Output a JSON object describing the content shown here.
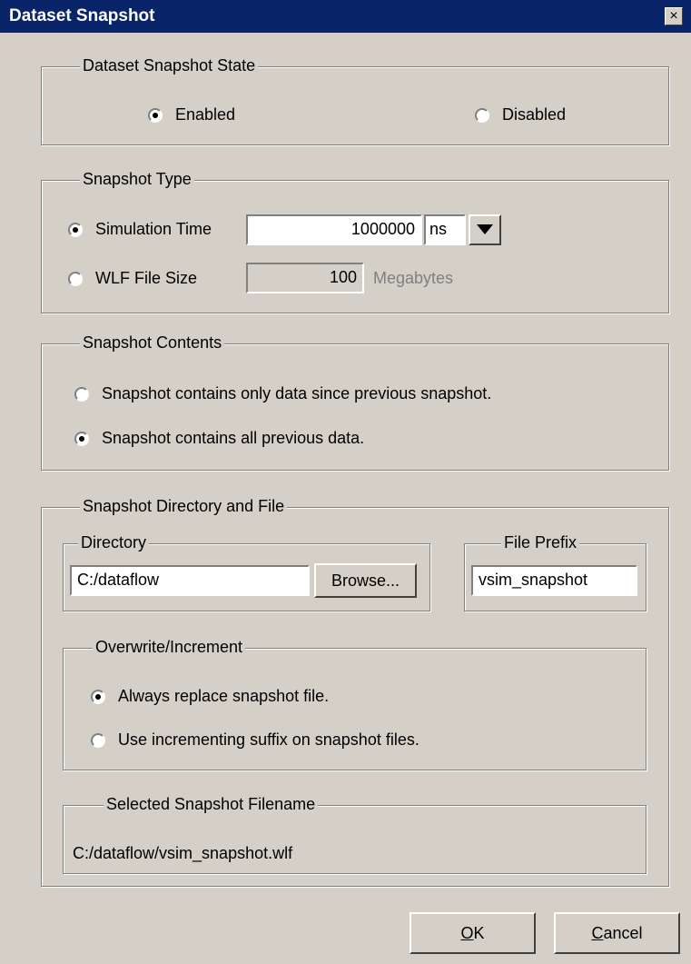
{
  "window": {
    "title": "Dataset Snapshot",
    "close_glyph": "×"
  },
  "state_group": {
    "legend": "Dataset Snapshot State",
    "options": [
      {
        "label": "Enabled",
        "checked": true
      },
      {
        "label": "Disabled",
        "checked": false
      }
    ]
  },
  "type_group": {
    "legend": "Snapshot Type",
    "sim_time": {
      "label": "Simulation Time",
      "checked": true,
      "value": "1000000",
      "unit": "ns"
    },
    "wlf_size": {
      "label": "WLF File Size",
      "checked": false,
      "value": "100",
      "unit": "Megabytes"
    }
  },
  "contents_group": {
    "legend": "Snapshot Contents",
    "options": [
      {
        "label": "Snapshot contains only data since previous snapshot.",
        "checked": false
      },
      {
        "label": "Snapshot contains all previous data.",
        "checked": true
      }
    ]
  },
  "dirfile_group": {
    "legend": "Snapshot Directory and File",
    "directory": {
      "legend": "Directory",
      "value": "C:/dataflow",
      "browse_label": "Browse..."
    },
    "prefix": {
      "legend": "File Prefix",
      "value": "vsim_snapshot"
    },
    "overwrite": {
      "legend": "Overwrite/Increment",
      "options": [
        {
          "label": "Always replace snapshot file.",
          "checked": true
        },
        {
          "label": "Use incrementing suffix on snapshot files.",
          "checked": false
        }
      ]
    },
    "selected": {
      "legend": "Selected Snapshot Filename",
      "value": "C:/dataflow/vsim_snapshot.wlf"
    }
  },
  "buttons": {
    "ok_underlined": "O",
    "ok_rest": "K",
    "cancel_underlined": "C",
    "cancel_rest": "ancel"
  }
}
